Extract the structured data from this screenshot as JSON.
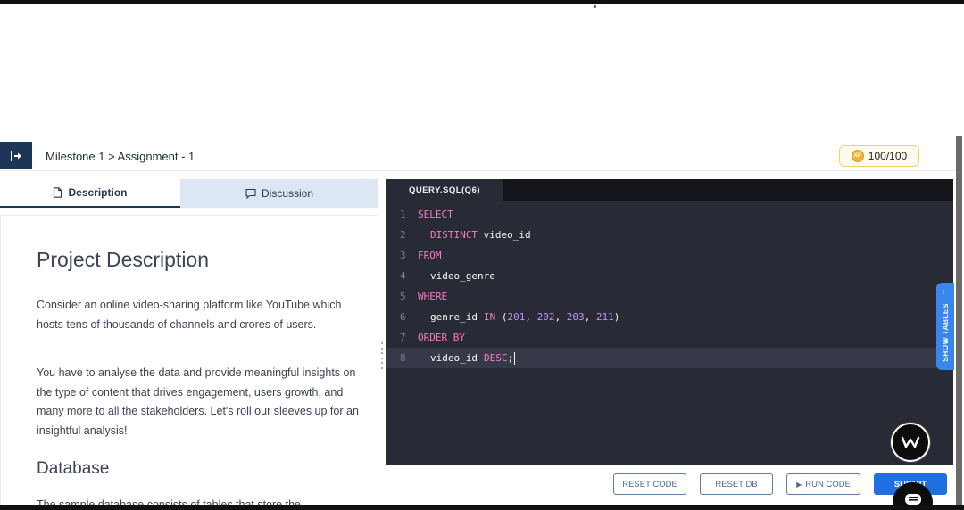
{
  "header": {
    "breadcrumb": "Milestone 1 > Assignment - 1",
    "score": "100/100",
    "coin_label": "XP"
  },
  "tabs": {
    "description": "Description",
    "discussion": "Discussion"
  },
  "content": {
    "title": "Project Description",
    "para1": "Consider an online video-sharing platform like YouTube which hosts tens of thousands of channels and crores of users.",
    "para2": "You have to analyse the data and provide meaningful insights on the type of content that drives engagement, users growth, and many more to all the stakeholders. Let's roll our sleeves up for an insightful analysis!",
    "section_title": "Database",
    "para3": "The sample database consists of tables that store the"
  },
  "editor": {
    "tab_label": "QUERY.SQL(Q6)",
    "lines": [
      {
        "num": "1",
        "kw": "SELECT",
        "rest": ""
      },
      {
        "num": "2",
        "kw": "DISTINCT",
        "rest": " video_id"
      },
      {
        "num": "3",
        "kw": "FROM",
        "rest": ""
      },
      {
        "num": "4",
        "kw": "",
        "rest": "video_genre"
      },
      {
        "num": "5",
        "kw": "WHERE",
        "rest": ""
      },
      {
        "num": "6",
        "id": "genre_id",
        "kw2": "IN",
        "nums": [
          "201",
          "202",
          "203",
          "211"
        ]
      },
      {
        "num": "7",
        "kw": "ORDER BY",
        "rest": ""
      },
      {
        "num": "8",
        "id": "video_id",
        "kw2": "DESC",
        "tail": ";"
      }
    ]
  },
  "buttons": {
    "reset_code": "RESET CODE",
    "reset_db": "RESET DB",
    "run_code": "RUN CODE",
    "submit": "SUBMIT"
  },
  "side": {
    "show_tables": "SHOW TABLES"
  },
  "colors": {
    "brand_navy": "#1d3556",
    "accent_blue": "#1f6fe0",
    "editor_bg": "#282a36",
    "keyword": "#ff79c6",
    "number": "#bd93f9"
  }
}
